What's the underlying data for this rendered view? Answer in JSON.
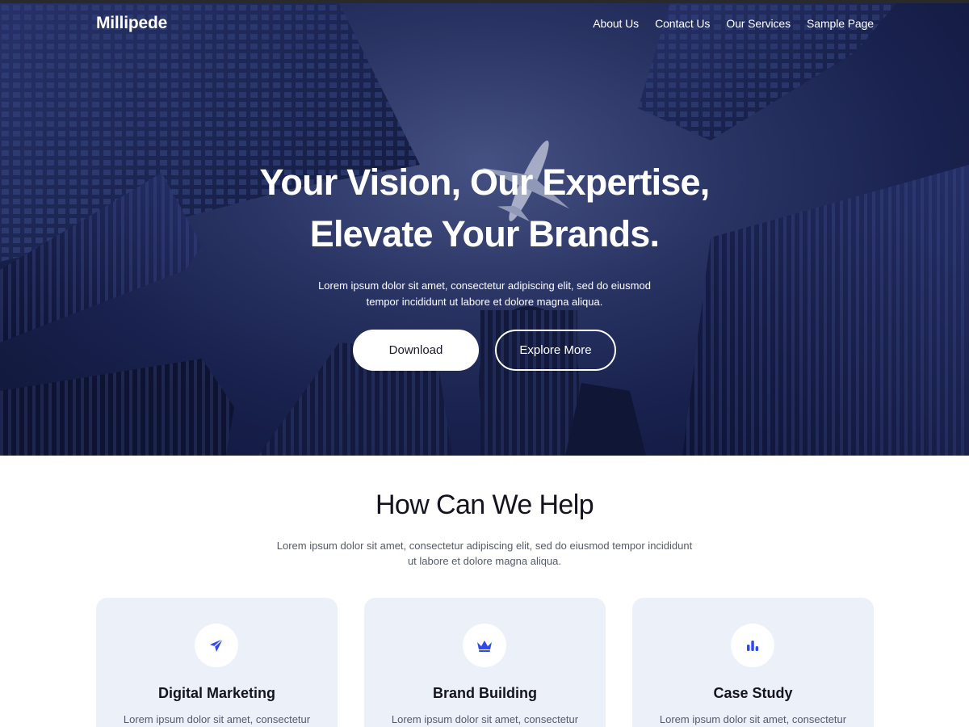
{
  "site": {
    "logo": "Millipede"
  },
  "nav": {
    "items": [
      {
        "label": "About Us"
      },
      {
        "label": "Contact Us"
      },
      {
        "label": "Our Services"
      },
      {
        "label": "Sample Page"
      }
    ]
  },
  "hero": {
    "title_line1": "Your Vision, Our Expertise,",
    "title_line2": "Elevate Your Brands.",
    "subtitle": "Lorem ipsum dolor sit amet, consectetur adipiscing elit, sed do eiusmod tempor incididunt ut labore et dolore magna aliqua.",
    "primary_button": "Download",
    "secondary_button": "Explore More"
  },
  "help": {
    "title": "How Can We Help",
    "subtitle": "Lorem ipsum dolor sit amet, consectetur adipiscing elit, sed do eiusmod tempor incididunt ut labore et dolore magna aliqua.",
    "cards": [
      {
        "icon": "paper-plane-icon",
        "title": "Digital Marketing",
        "text": "Lorem ipsum dolor sit amet, consectetur"
      },
      {
        "icon": "crown-icon",
        "title": "Brand Building",
        "text": "Lorem ipsum dolor sit amet, consectetur"
      },
      {
        "icon": "bar-chart-icon",
        "title": "Case Study",
        "text": "Lorem ipsum dolor sit amet, consectetur"
      }
    ]
  },
  "colors": {
    "accent": "#2f49f0",
    "card_bg": "#ecf0f9",
    "hero_bg": "#1a2350",
    "heading": "#141420",
    "body_text": "#55596a"
  }
}
